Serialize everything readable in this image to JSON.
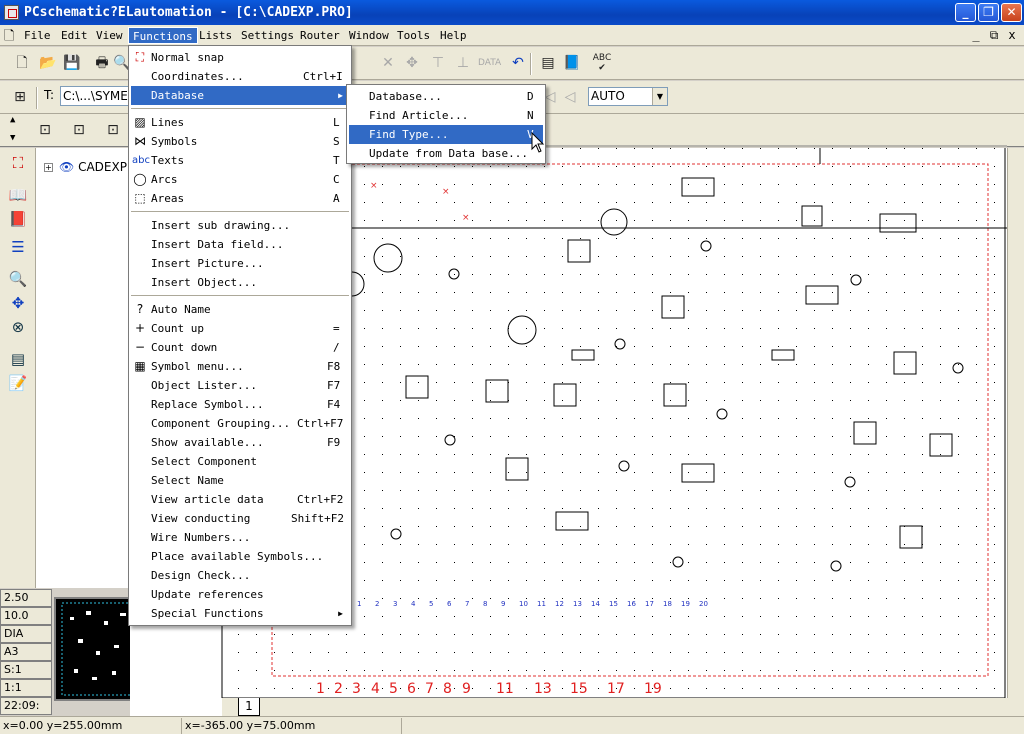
{
  "window": {
    "title": "PCschematic?ELautomation - [C:\\CADEXP.PRO]",
    "controls": [
      "minimize",
      "restore",
      "close"
    ]
  },
  "menubar": {
    "items": [
      "File",
      "Edit",
      "View",
      "Functions",
      "Lists",
      "Settings",
      "Router",
      "Window",
      "Tools",
      "Help"
    ],
    "active": "Functions",
    "mdi_controls": [
      "_",
      "⧉",
      "x"
    ]
  },
  "toolbar2": {
    "t_label": "T:",
    "t_value": "C:\\...\\SYME",
    "combo_value": "AUTO"
  },
  "tree": {
    "node": "CADEXP"
  },
  "left_status": [
    "2.50",
    "10.0",
    "DIA",
    "A3",
    "S:1",
    "1:1",
    "22:09:"
  ],
  "statusbar": {
    "pos1": "x=0.00 y=255.00mm",
    "pos2": "x=-365.00 y=75.00mm"
  },
  "canvas": {
    "page_tab": "1",
    "column_numbers": [
      "1",
      "2",
      "3",
      "4",
      "5",
      "6",
      "7",
      "8",
      "9",
      "11",
      "13",
      "15",
      "17",
      "19"
    ],
    "small_numbers": [
      "1",
      "2",
      "3",
      "4",
      "5",
      "6",
      "7",
      "8",
      "9",
      "10",
      "11",
      "12",
      "13",
      "14",
      "15",
      "16",
      "17",
      "18",
      "19",
      "20"
    ]
  },
  "functions_menu": {
    "items": [
      {
        "label": "Normal snap",
        "shortcut": "",
        "icon": "grid-snap-icon"
      },
      {
        "label": "Coordinates...",
        "shortcut": "Ctrl+I"
      },
      {
        "label": "Database",
        "shortcut": "",
        "submenu": true,
        "highlight": true
      },
      {
        "sep": true
      },
      {
        "label": "Lines",
        "shortcut": "L",
        "icon": "lines-icon"
      },
      {
        "label": "Symbols",
        "shortcut": "S",
        "icon": "symbols-icon"
      },
      {
        "label": "Texts",
        "shortcut": "T",
        "icon": "texts-icon"
      },
      {
        "label": "Arcs",
        "shortcut": "C",
        "icon": "arcs-icon"
      },
      {
        "label": "Areas",
        "shortcut": "A",
        "icon": "areas-icon"
      },
      {
        "sep": true
      },
      {
        "label": "Insert sub drawing...",
        "shortcut": ""
      },
      {
        "label": "Insert Data field...",
        "shortcut": ""
      },
      {
        "label": "Insert Picture...",
        "shortcut": ""
      },
      {
        "label": "Insert Object...",
        "shortcut": ""
      },
      {
        "sep": true
      },
      {
        "label": "Auto Name",
        "shortcut": "",
        "icon": "auto-name-icon"
      },
      {
        "label": "Count up",
        "shortcut": "=",
        "icon": "plus-icon"
      },
      {
        "label": "Count down",
        "shortcut": "/",
        "icon": "minus-icon"
      },
      {
        "label": "Symbol menu...",
        "shortcut": "F8",
        "icon": "symbol-menu-icon"
      },
      {
        "label": "Object Lister...",
        "shortcut": "F7"
      },
      {
        "label": "Replace Symbol...",
        "shortcut": "F4"
      },
      {
        "label": "Component Grouping...",
        "shortcut": "Ctrl+F7"
      },
      {
        "label": "Show available...",
        "shortcut": "F9"
      },
      {
        "label": "Select Component",
        "shortcut": ""
      },
      {
        "label": "Select Name",
        "shortcut": ""
      },
      {
        "label": "View article data",
        "shortcut": "Ctrl+F2"
      },
      {
        "label": "View conducting",
        "shortcut": "Shift+F2"
      },
      {
        "label": "Wire Numbers...",
        "shortcut": ""
      },
      {
        "label": "Place available Symbols...",
        "shortcut": ""
      },
      {
        "label": "Design Check...",
        "shortcut": ""
      },
      {
        "label": "Update references",
        "shortcut": ""
      },
      {
        "label": "Special Functions",
        "shortcut": "",
        "submenu": true
      }
    ]
  },
  "database_submenu": {
    "items": [
      {
        "label": "Database...",
        "shortcut": "D"
      },
      {
        "label": "Find Article...",
        "shortcut": "N"
      },
      {
        "label": "Find Type...",
        "shortcut": "V",
        "highlight": true
      },
      {
        "label": "Update from Data base...",
        "shortcut": ""
      }
    ]
  },
  "colors": {
    "title_blue": "#0842b8",
    "menu_highlight": "#316ac5",
    "border_red": "#e03030",
    "column_red": "#e02020",
    "number_blue": "#2030c0"
  }
}
